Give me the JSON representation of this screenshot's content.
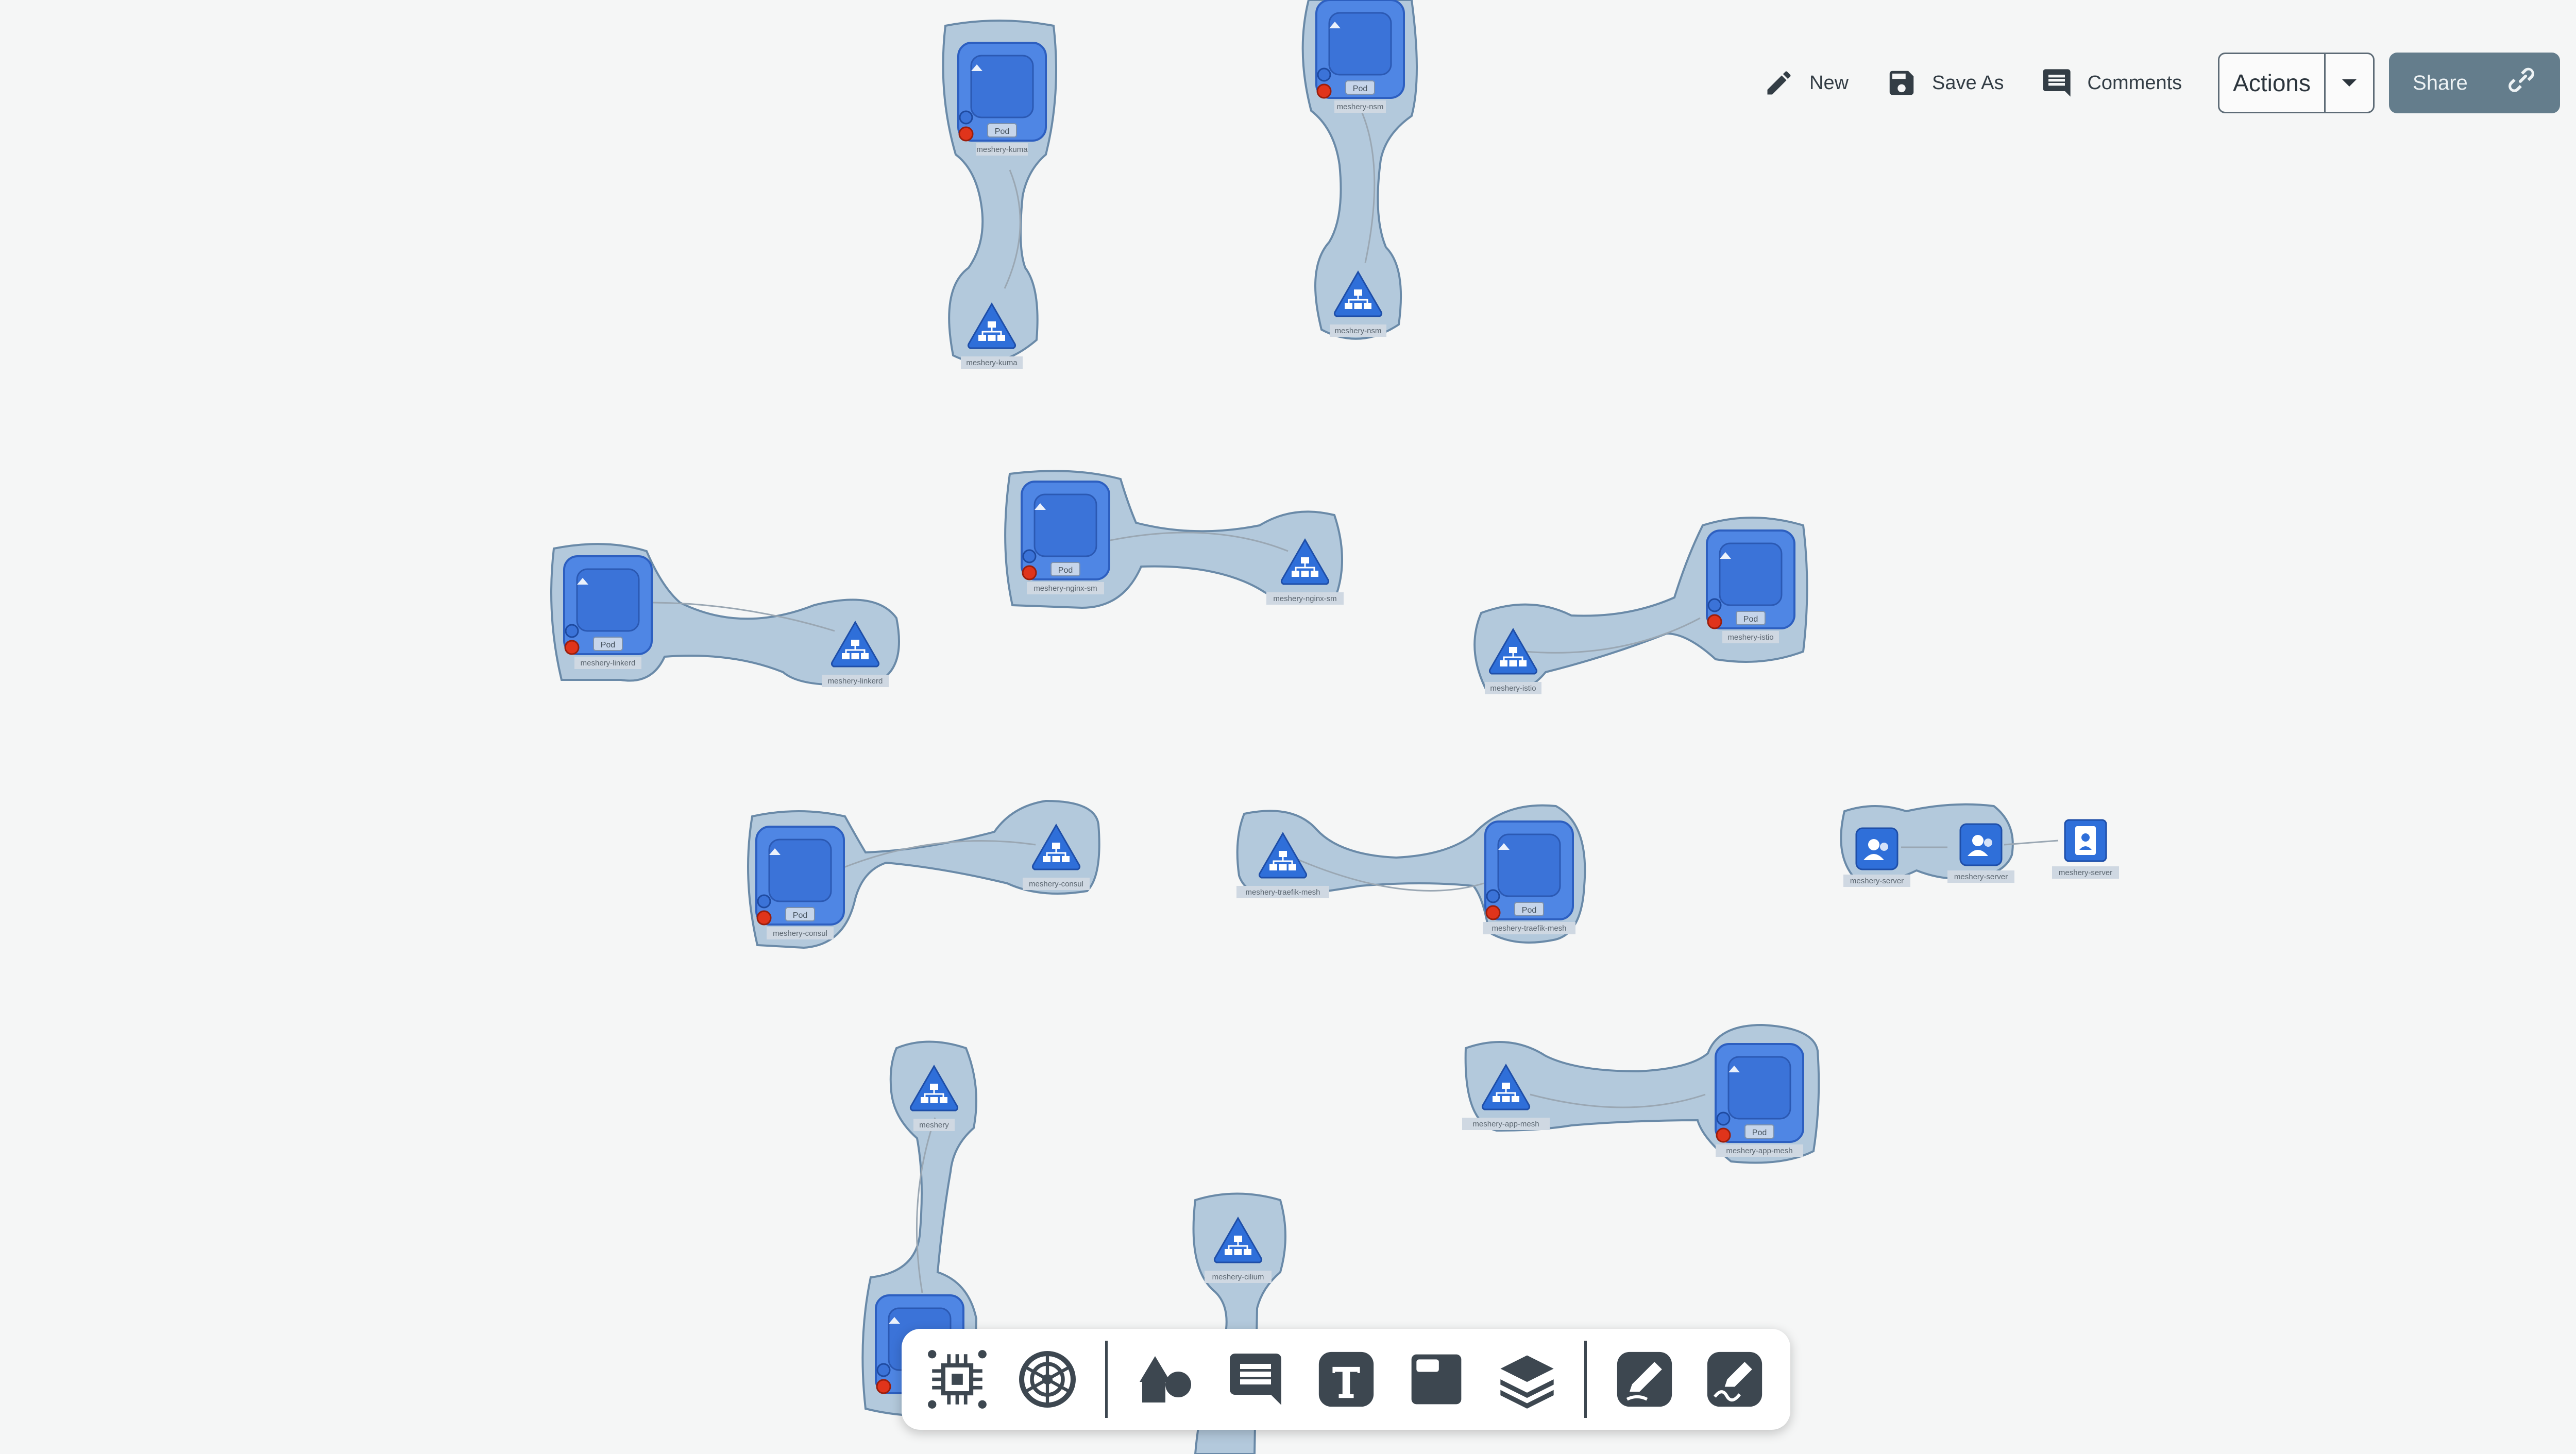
{
  "toolbar": {
    "new_label": "New",
    "save_as_label": "Save As",
    "comments_label": "Comments",
    "actions_label": "Actions",
    "share_label": "Share"
  },
  "colors": {
    "canvas_bg": "#f5f6f6",
    "group_fill": "#b3c9dc",
    "group_stroke": "#6a8aa8",
    "node_blue": "#3b73d8",
    "pod_inner": "#2f64c9",
    "error_dot": "#e0341b",
    "share_bg": "#647d8c"
  },
  "canvas": {
    "pod_label": "Pod",
    "groups": [
      {
        "service_label": "meshery-kuma",
        "pod_label": "meshery-kuma"
      },
      {
        "service_label": "meshery-nsm",
        "pod_label": "meshery-nsm"
      },
      {
        "service_label": "meshery-linkerd",
        "pod_label": "meshery-linkerd"
      },
      {
        "service_label": "meshery-nginx-sm",
        "pod_label": "meshery-nginx-sm"
      },
      {
        "service_label": "meshery-istio",
        "pod_label": "meshery-istio"
      },
      {
        "service_label": "meshery-consul",
        "pod_label": "meshery-consul"
      },
      {
        "service_label": "meshery-traefik-mesh",
        "pod_label": "meshery-traefik-mesh"
      },
      {
        "service_label": "meshery-app-mesh",
        "pod_label": "meshery-app-mesh"
      },
      {
        "service_label": "meshery",
        "pod_label": ""
      },
      {
        "service_label": "meshery-cilium",
        "pod_label": ""
      }
    ],
    "server_nodes": [
      "meshery-server",
      "meshery-server",
      "meshery-server"
    ]
  },
  "dock": {
    "items": [
      {
        "icon": "component-icon"
      },
      {
        "icon": "kubernetes-icon"
      },
      {
        "icon": "shapes-icon"
      },
      {
        "icon": "comment-icon"
      },
      {
        "icon": "text-icon"
      },
      {
        "icon": "section-icon"
      },
      {
        "icon": "layers-icon"
      },
      {
        "icon": "pen-icon"
      },
      {
        "icon": "freehand-icon"
      }
    ]
  }
}
